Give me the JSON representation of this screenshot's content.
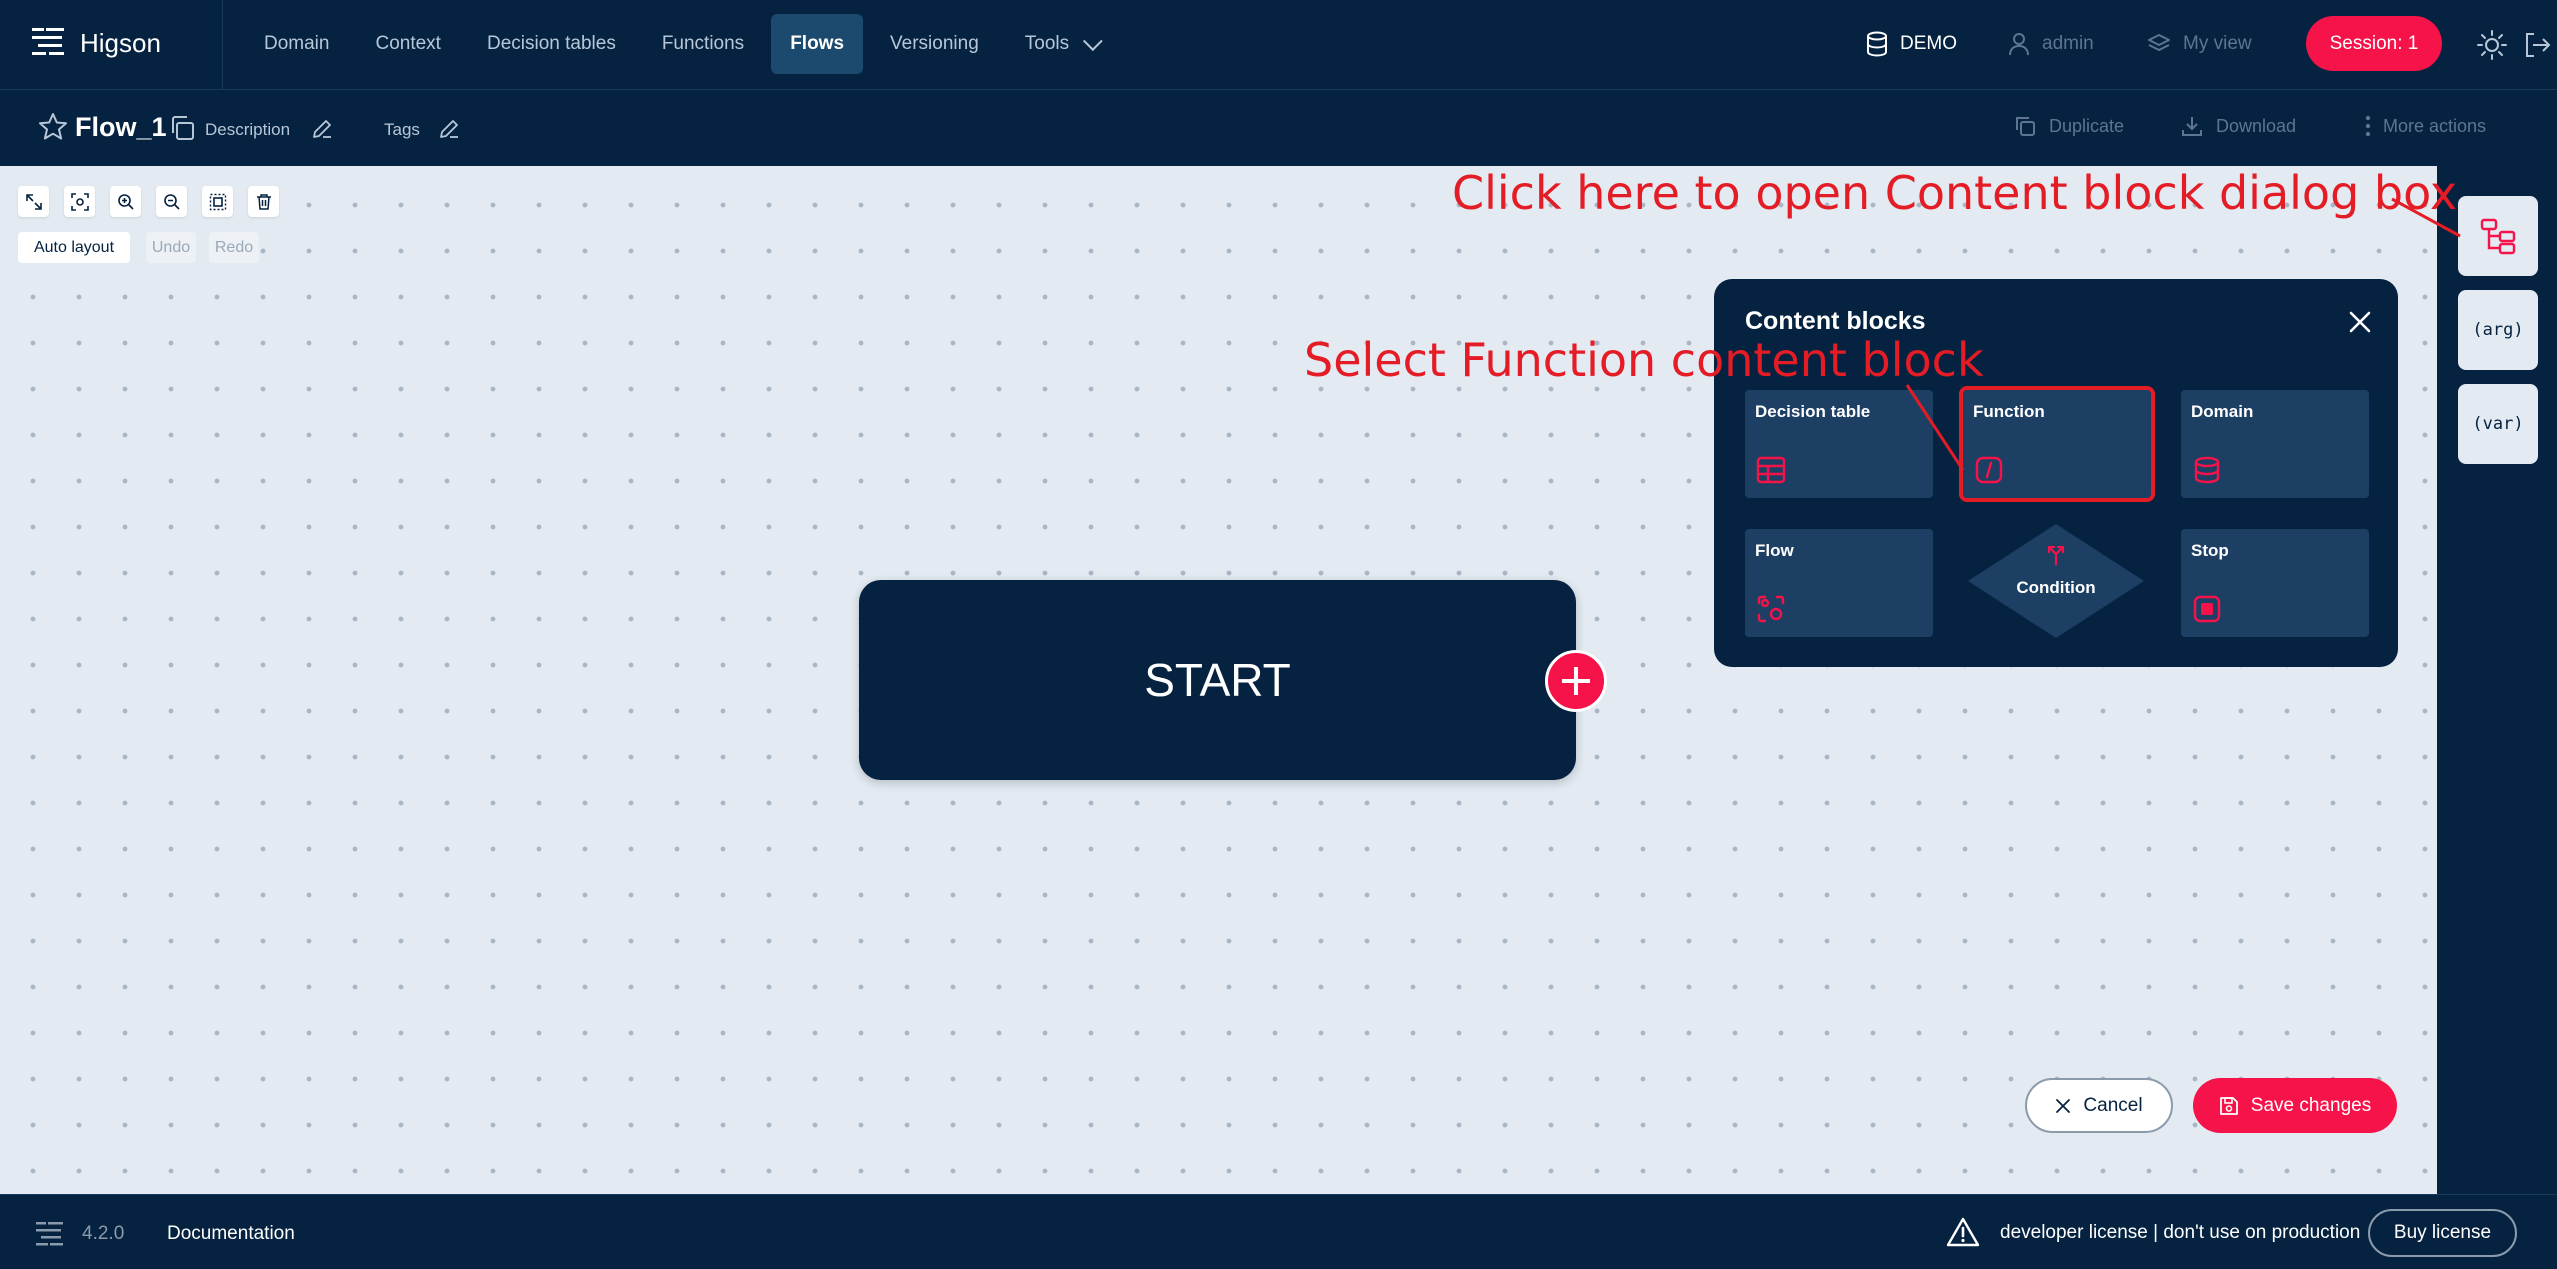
{
  "app": {
    "name": "Higson"
  },
  "nav": {
    "items": [
      {
        "label": "Domain"
      },
      {
        "label": "Context"
      },
      {
        "label": "Decision tables"
      },
      {
        "label": "Functions"
      },
      {
        "label": "Flows",
        "active": true
      },
      {
        "label": "Versioning"
      },
      {
        "label": "Tools"
      }
    ],
    "env": "DEMO",
    "user": "admin",
    "view": "My view",
    "session": "Session: 1"
  },
  "toolbar": {
    "flow_name": "Flow_1",
    "description_label": "Description",
    "tags_label": "Tags",
    "duplicate_label": "Duplicate",
    "download_label": "Download",
    "more_label": "More actions"
  },
  "canvas": {
    "auto_layout": "Auto layout",
    "undo": "Undo",
    "redo": "Redo",
    "start_label": "START"
  },
  "content_blocks": {
    "title": "Content blocks",
    "tiles": {
      "decision_table": "Decision table",
      "function": "Function",
      "domain": "Domain",
      "flow": "Flow",
      "condition": "Condition",
      "stop": "Stop"
    }
  },
  "sidebar": {
    "arg_label": "(arg)",
    "var_label": "(var)"
  },
  "annotations": {
    "open_dialog": "Click here to open Content block dialog box",
    "select_function": "Select Function content block"
  },
  "actions": {
    "cancel": "Cancel",
    "save": "Save changes"
  },
  "footer": {
    "version": "4.2.0",
    "documentation": "Documentation",
    "license_note": "developer license | don't use on production",
    "buy": "Buy license"
  },
  "colors": {
    "navy": "#052240",
    "accent": "#f5134a",
    "annotation": "#e41c25",
    "canvas": "#e3eaf2",
    "tile": "#1c3f63"
  }
}
